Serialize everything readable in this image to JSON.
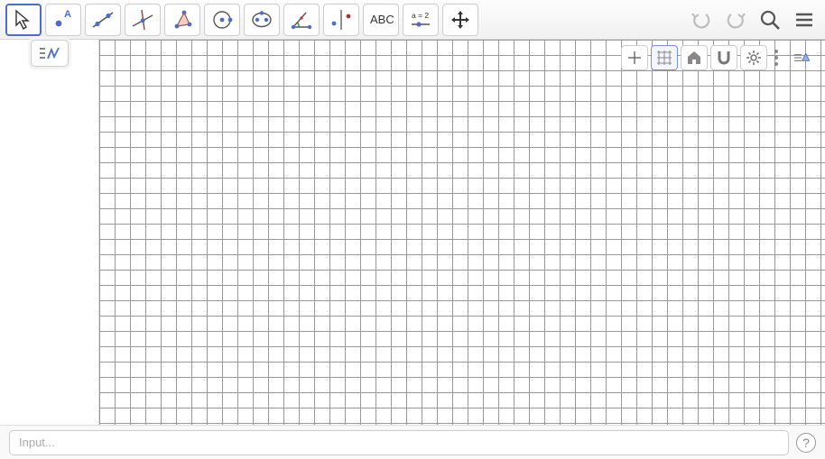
{
  "toolbar": {
    "tools": [
      {
        "name": "move-tool",
        "selected": true
      },
      {
        "name": "point-tool"
      },
      {
        "name": "line-tool"
      },
      {
        "name": "perpendicular-line-tool"
      },
      {
        "name": "polygon-tool"
      },
      {
        "name": "circle-tool"
      },
      {
        "name": "ellipse-tool"
      },
      {
        "name": "angle-tool"
      },
      {
        "name": "reflect-tool"
      },
      {
        "name": "text-tool",
        "label": "ABC"
      },
      {
        "name": "slider-tool",
        "label": "a = 2"
      },
      {
        "name": "move-graphics-tool"
      }
    ],
    "undo": "Undo",
    "redo": "Redo",
    "search": "Search",
    "menu": "Menu"
  },
  "algebra": {
    "toggle": "Algebra View"
  },
  "graphics": {
    "controls": {
      "axes": "Show Axes",
      "grid": "Show Grid",
      "home": "Standard View",
      "snap": "Point Capturing",
      "settings": "Settings",
      "more": "More",
      "style": "Graphics View Style"
    }
  },
  "input": {
    "placeholder": "Input...",
    "value": "",
    "help": "?"
  }
}
